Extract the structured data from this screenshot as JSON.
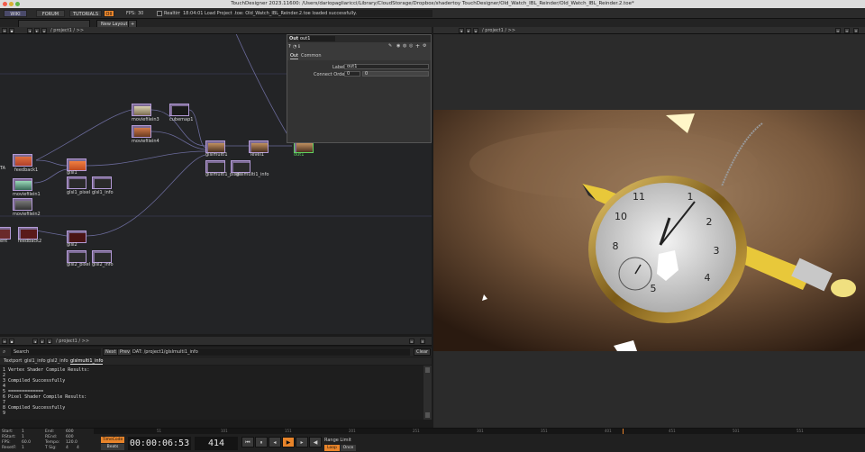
{
  "window": {
    "title": "TouchDesigner 2023.11600: /Users/dariopagliaricci/Library/CloudStorage/Dropbox/shadertoy TouchDesigner/Old_Watch_IBL_Reinder/Old_Watch_IBL_Reinder.2.toe*"
  },
  "menubar": {
    "wiki": "WIKI",
    "forum": "FORUM",
    "tutorials": "TUTORIALS",
    "oii": "OII",
    "fps_label": "FPS:",
    "fps_value": "30",
    "realtime": "Realtime",
    "status": "18:04:01 Load Project .toe: Old_Watch_IBL_Reinder.2.toe loaded successfully."
  },
  "tabbar": {
    "new_layout": "New Layout",
    "plus": "+"
  },
  "network_pane": {
    "path": "/ project1 / >>"
  },
  "viewer_pane": {
    "path": "/ project1 / >>"
  },
  "nodes": [
    {
      "id": "moviefilein3",
      "label": "moviefilein3"
    },
    {
      "id": "cubemap1",
      "label": "cubemap1"
    },
    {
      "id": "moviefilein4",
      "label": "moviefilein4"
    },
    {
      "id": "feedback1",
      "label": "feedback1"
    },
    {
      "id": "glsl1",
      "label": "glsl1"
    },
    {
      "id": "moviefilein1",
      "label": "moviefilein1"
    },
    {
      "id": "glsl1_pixel",
      "label": "glsl1_pixel"
    },
    {
      "id": "glsl1_info",
      "label": "glsl1_info"
    },
    {
      "id": "moviefilein2",
      "label": "moviefilein2"
    },
    {
      "id": "glslmulti1",
      "label": "glslmulti1"
    },
    {
      "id": "level1",
      "label": "level1"
    },
    {
      "id": "out1",
      "label": "out1"
    },
    {
      "id": "glslmulti1_pixel",
      "label": "glslmulti1_pixel"
    },
    {
      "id": "glslmulti1_info",
      "label": "glslmulti1_info"
    },
    {
      "id": "feedback2",
      "label": "feedback2"
    },
    {
      "id": "glsl2",
      "label": "glsl2"
    },
    {
      "id": "glsl2_pixel",
      "label": "glsl2_pixel"
    },
    {
      "id": "glsl2_info",
      "label": "glsl2_info"
    },
    {
      "id": "ta",
      "label": "TA"
    },
    {
      "id": "ent",
      "label": "ent"
    }
  ],
  "params": {
    "op_type": "Out",
    "op_name": "out1",
    "tabs": [
      "Out",
      "Common"
    ],
    "label_name": "Label",
    "label_value": "out1",
    "connect_order_name": "Connect Order",
    "connect_order_value": "0",
    "connect_order_value2": "0"
  },
  "bottom_left": {
    "path": "/ project1 / >>",
    "search_label": "Search",
    "next": "Next",
    "prev": "Prev",
    "dat_path": "DAT: /project1/glslmulti1_info",
    "clear": "Clear",
    "tabs": [
      "Textport",
      "glsl1_info",
      "glsl2_info",
      "glslmulti1_info"
    ],
    "lines": [
      "1 Vertex Shader Compile Results:",
      "2",
      "3 Compiled Successfully",
      "4",
      "5 =============",
      "6 Pixel Shader Compile Results:",
      "7",
      "8 Compiled Successfully",
      "9"
    ]
  },
  "timeline": {
    "start_label": "Start:",
    "start_value": "1",
    "rstart_label": "RStart:",
    "rstart_value": "1",
    "fps_label": "FPS:",
    "fps_value": "60.0",
    "reset_label": "ResetF:",
    "reset_value": "1",
    "end_label": "End:",
    "end_value": "600",
    "rend_label": "REnd:",
    "rend_value": "600",
    "tempo_label": "Tempo:",
    "tempo_value": "120.0",
    "tsig_label": "T Sig:",
    "tsig_value1": "4",
    "tsig_value2": "4",
    "timecode_btn": "TimeCode",
    "beats_btn": "Beats",
    "timecode": "00:00:06:53",
    "frame": "414",
    "range_limit": "Range Limit",
    "loop": "Loop",
    "once": "Once",
    "ticks": [
      "51",
      "101",
      "151",
      "201",
      "251",
      "301",
      "351",
      "401",
      "451",
      "501",
      "551"
    ]
  },
  "colors": {
    "node_top": "#7c6a93",
    "out_selected": "#5fd15f",
    "accent_orange": "#e8842a"
  }
}
